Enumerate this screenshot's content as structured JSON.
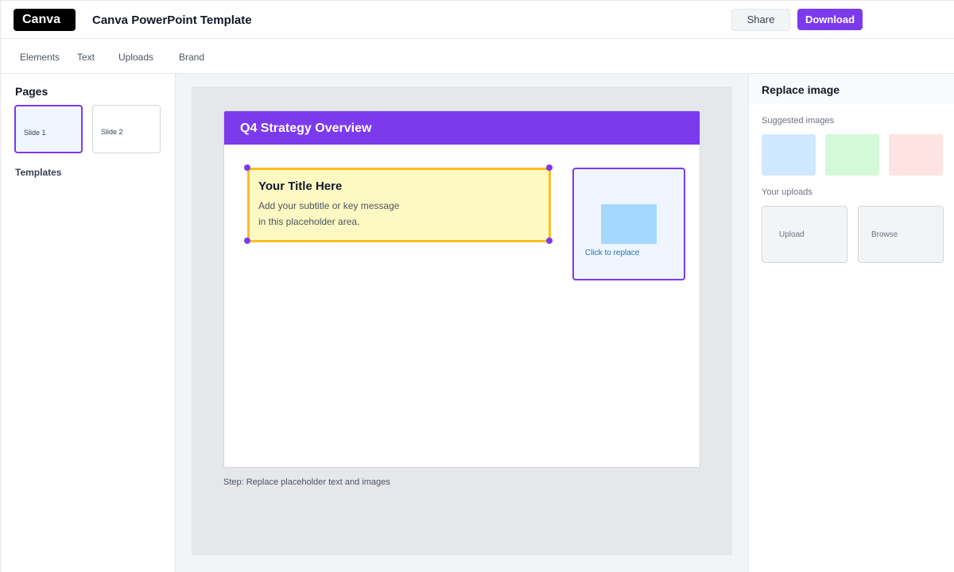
{
  "topbar": {
    "logo": "Canva",
    "doc_title": "Canva PowerPoint Template",
    "share_label": "Share",
    "download_label": "Download"
  },
  "tabs": [
    {
      "label": "Elements"
    },
    {
      "label": "Text"
    },
    {
      "label": "Uploads"
    },
    {
      "label": "Brand"
    }
  ],
  "left_panel": {
    "pages_heading": "Pages",
    "pages": [
      {
        "label": "Slide 1",
        "selected": true
      },
      {
        "label": "Slide 2",
        "selected": false
      }
    ],
    "templates_heading": "Templates"
  },
  "slide": {
    "header_title": "Q4 Strategy Overview",
    "text_placeholder": {
      "title": "Your Title Here",
      "line1": "Add your subtitle or key message",
      "line2": "in this placeholder area."
    },
    "image_placeholder": {
      "caption": "Click to replace"
    }
  },
  "step_text": "Step: Replace placeholder text and images",
  "right_panel": {
    "title": "Replace image",
    "suggested_label": "Suggested images",
    "uploads_label": "Your uploads",
    "upload_label": "Upload",
    "browse_label": "Browse"
  },
  "colors": {
    "accent": "#7c3aed",
    "selection": "#fbbf24",
    "placeholder_fill": "#fef9c3",
    "link": "#1d6fb8",
    "suggested": [
      "#d0e8ff",
      "#d3f9d8",
      "#ffe3e3"
    ]
  }
}
